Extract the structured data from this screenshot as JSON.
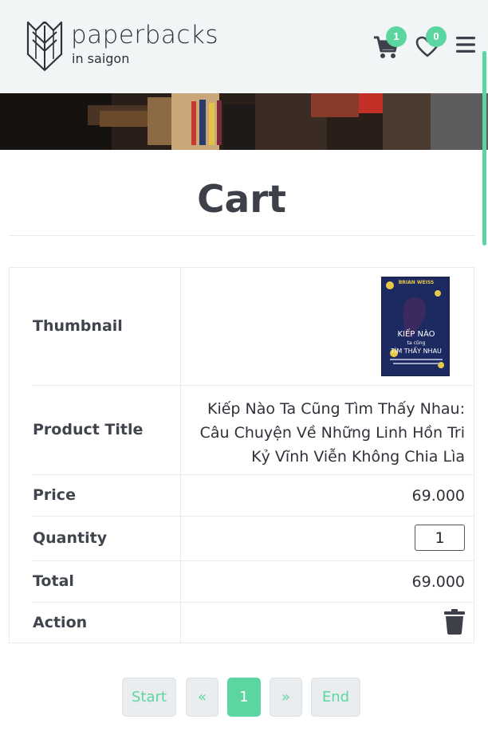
{
  "brand": {
    "name": "paperbacks",
    "tagline": "in saigon"
  },
  "header": {
    "cart_count": "1",
    "wishlist_count": "0"
  },
  "page": {
    "title": "Cart"
  },
  "cart": {
    "labels": {
      "thumbnail": "Thumbnail",
      "product_title": "Product Title",
      "price": "Price",
      "quantity": "Quantity",
      "total": "Total",
      "action": "Action"
    },
    "item": {
      "title_line1": "Kiếp Nào Ta Cũng Tìm Thấy Nhau:",
      "title_line2": "Câu Chuyện Về Những Linh Hồn Tri",
      "title_line3": "Kỷ Vĩnh Viễn Không Chia Lìa",
      "price": "69.000",
      "quantity": "1",
      "total": "69.000",
      "cover_author": "BRIAN WEISS",
      "cover_title_a": "KIẾP NÀO",
      "cover_title_b": "ta cũng",
      "cover_title_c": "TÌM THẤY NHAU"
    }
  },
  "pagination": {
    "start": "Start",
    "prev": "«",
    "current": "1",
    "next": "»",
    "end": "End"
  },
  "colors": {
    "accent": "#5cd6a0",
    "text": "#3d4049",
    "header_bg": "#f2f5f6"
  }
}
